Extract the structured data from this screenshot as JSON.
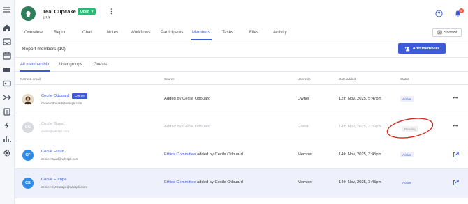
{
  "header": {
    "title": "Teal Cupcake",
    "id": "133",
    "status_label": "Open",
    "notifications_count": "5"
  },
  "tabs": [
    {
      "label": "Overview"
    },
    {
      "label": "Report"
    },
    {
      "label": "Chat"
    },
    {
      "label": "Notes"
    },
    {
      "label": "Workflows"
    },
    {
      "label": "Participants"
    },
    {
      "label": "Members"
    },
    {
      "label": "Tasks"
    },
    {
      "label": "Files"
    },
    {
      "label": "Activity"
    }
  ],
  "active_tab": "Members",
  "snooze_label": "Snooze",
  "members": {
    "title": "Report members (10)",
    "add_label": "Add members",
    "subtabs": [
      {
        "label": "All membership"
      },
      {
        "label": "User groups"
      },
      {
        "label": "Guests"
      }
    ],
    "columns": {
      "name": "Name & email",
      "source": "Source",
      "role": "User role",
      "date": "Date added",
      "status": "Status"
    },
    "rows": [
      {
        "initials": "",
        "name": "Cecile Odouard",
        "tag": "Owner",
        "email": "cecile.odouard@whispli.com",
        "source_prefix": "Added by Cecile Odouard",
        "source_link": "",
        "source_suffix": "",
        "role": "Owner",
        "date": "12th Nov, 2025, 5:47pm",
        "status": "Active"
      },
      {
        "initials": "CG",
        "name": "Cecile Guest",
        "tag": "",
        "email": "cecile@whispli.com",
        "source_prefix": "Added by Cecile Odouard",
        "source_link": "",
        "source_suffix": "",
        "role": "Guest",
        "date": "14th Nov, 2025, 3:56pm",
        "status": "Pending"
      },
      {
        "initials": "CF",
        "name": "Cecile Fraud",
        "tag": "",
        "email": "cecile+fraud@whispli.com",
        "source_prefix": "",
        "source_link": "Ethics Committee",
        "source_suffix": "added by Cecile Odouard",
        "role": "Member",
        "date": "14th Nov, 2025, 3:45pm",
        "status": "Active"
      },
      {
        "initials": "CE",
        "name": "Cecile Europe",
        "tag": "",
        "email": "cecile+CMEurope@whispli.com",
        "source_prefix": "",
        "source_link": "Ethics Committee",
        "source_suffix": "added by Cecile Odouard",
        "role": "Member",
        "date": "14th Nov, 2025, 3:45pm",
        "status": "Active"
      }
    ]
  },
  "colors": {
    "accent": "#3d5bd9",
    "open_green": "#2bb673",
    "avatar_blue": "#2f8be6",
    "annotation_red": "#d8241b"
  }
}
